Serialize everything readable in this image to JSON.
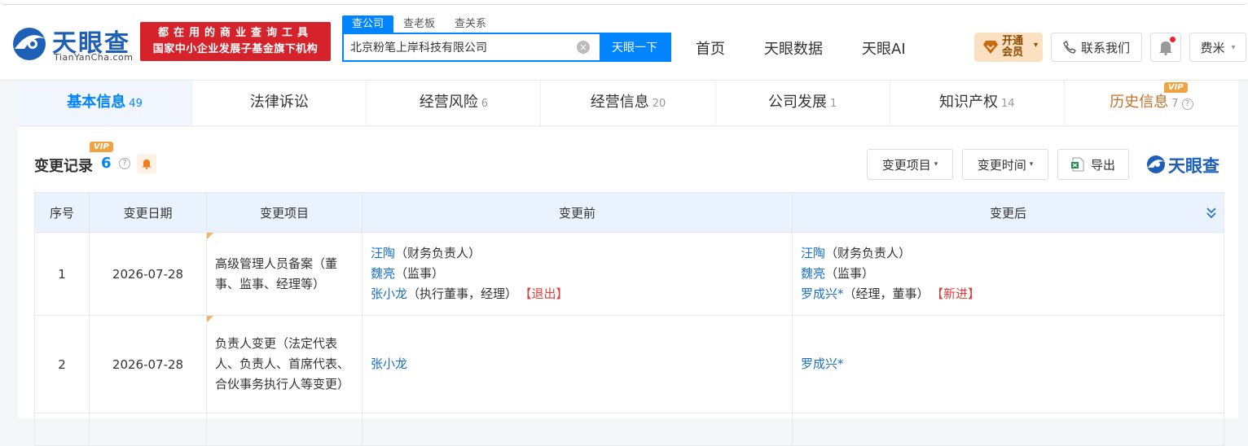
{
  "header": {
    "logo_text": "天眼查",
    "logo_sub": "TianYanCha.com",
    "slogan_line1": "都在用的商业查询工具",
    "slogan_line2": "国家中小企业发展子基金旗下机构",
    "search_tabs": [
      {
        "label": "查公司",
        "active": true
      },
      {
        "label": "查老板",
        "active": false
      },
      {
        "label": "查关系",
        "active": false
      }
    ],
    "search_value": "北京粉笔上岸科技有限公司",
    "search_button": "天眼一下",
    "nav": [
      "首页",
      "天眼数据",
      "天眼AI"
    ],
    "vip_line1": "开通",
    "vip_line2": "会员",
    "contact": "联系我们",
    "user": "费米"
  },
  "tabs": [
    {
      "label": "基本信息",
      "count": "49",
      "active": true
    },
    {
      "label": "法律诉讼",
      "count": ""
    },
    {
      "label": "经营风险",
      "count": "6"
    },
    {
      "label": "经营信息",
      "count": "20"
    },
    {
      "label": "公司发展",
      "count": "1"
    },
    {
      "label": "知识产权",
      "count": "14"
    },
    {
      "label": "历史信息",
      "count": "7"
    }
  ],
  "vip_tag": "VIP",
  "section": {
    "title": "变更记录",
    "count": "6",
    "filters": [
      "变更项目",
      "变更时间"
    ],
    "export": "导出",
    "watermark": "天眼查"
  },
  "table": {
    "headers": [
      "序号",
      "变更日期",
      "变更项目",
      "变更前",
      "变更后"
    ],
    "rows": [
      {
        "index": "1",
        "date": "2026-07-28",
        "item": "高级管理人员备案（董事、监事、经理等）",
        "before": [
          {
            "name": "汪陶",
            "role": "（财务负责人）",
            "tag": ""
          },
          {
            "name": "魏亮",
            "role": "（监事）",
            "tag": ""
          },
          {
            "name": "张小龙",
            "role": "（执行董事，经理）",
            "tag": "【退出】"
          }
        ],
        "after": [
          {
            "name": "汪陶",
            "role": "（财务负责人）",
            "tag": ""
          },
          {
            "name": "魏亮",
            "role": "（监事）",
            "tag": ""
          },
          {
            "name": "罗成兴*",
            "role": "（经理，董事）",
            "tag": "【新进】"
          }
        ]
      },
      {
        "index": "2",
        "date": "2026-07-28",
        "item": "负责人变更（法定代表人、负责人、首席代表、合伙事务执行人等变更）",
        "before_single": "张小龙",
        "after_single": "罗成兴*"
      }
    ]
  },
  "colors": {
    "brand_blue": "#0084ff",
    "logo_blue": "#1e5fb8",
    "slogan_red": "#d6222b",
    "link_blue": "#1a6fc4",
    "tag_red": "#e0403c",
    "vip_orange": "#f0a441"
  }
}
